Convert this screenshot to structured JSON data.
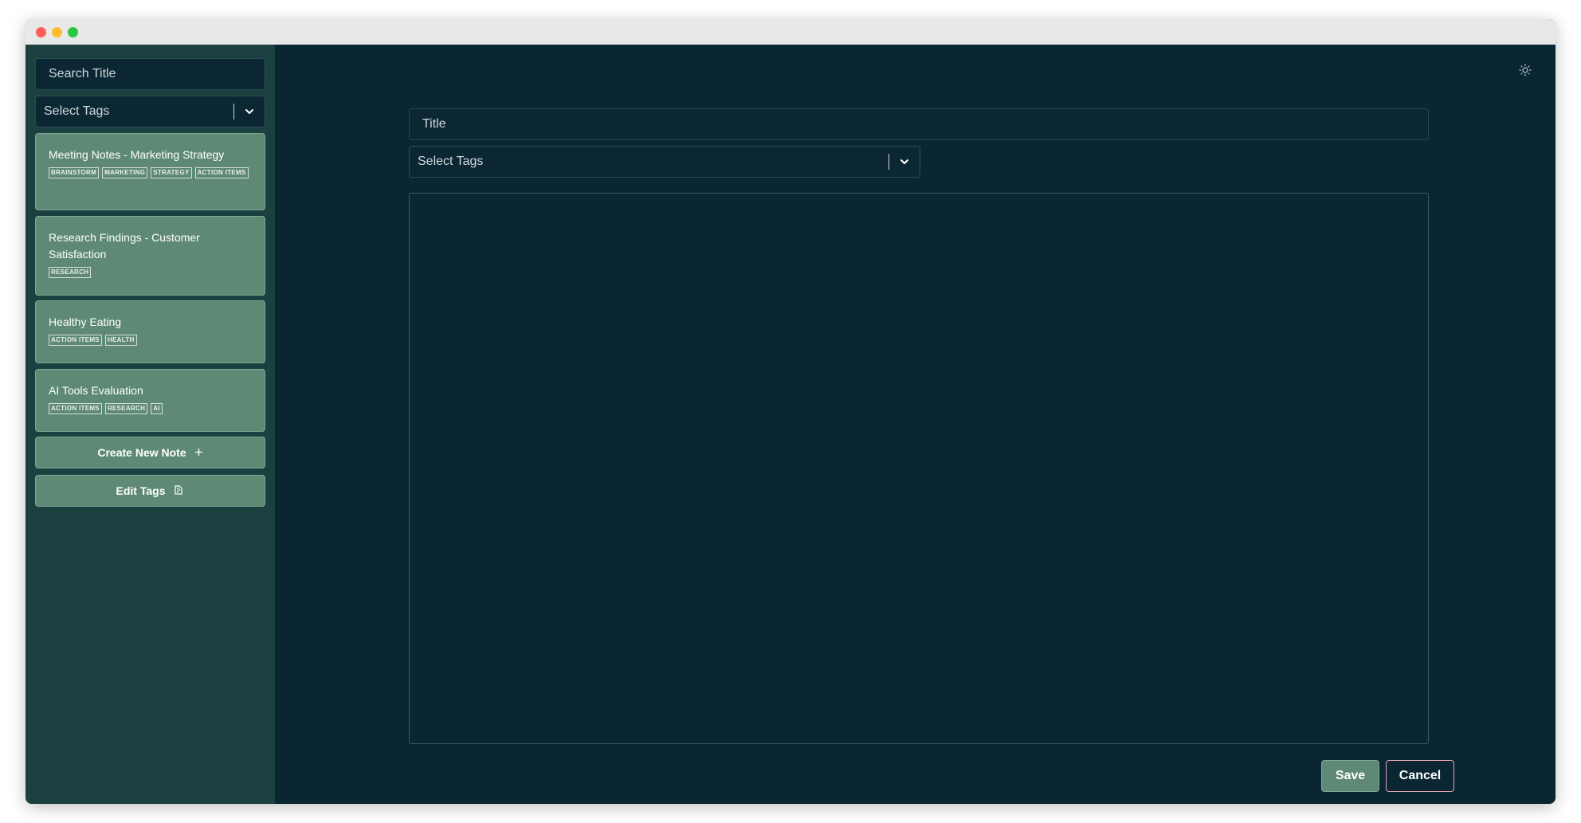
{
  "sidebar": {
    "search_placeholder": "Search Title",
    "tags_placeholder": "Select Tags",
    "notes": [
      {
        "title": "Meeting Notes - Marketing Strategy",
        "tags": [
          "BRAINSTORM",
          "MARKETING",
          "STRATEGY",
          "ACTION ITEMS"
        ]
      },
      {
        "title": "Research Findings - Customer Satisfaction",
        "tags": [
          "RESEARCH"
        ]
      },
      {
        "title": "Healthy Eating",
        "tags": [
          "ACTION ITEMS",
          "HEALTH"
        ]
      },
      {
        "title": "AI Tools Evaluation",
        "tags": [
          "ACTION ITEMS",
          "RESEARCH",
          "AI"
        ]
      }
    ],
    "create_note_label": "Create New Note",
    "edit_tags_label": "Edit Tags"
  },
  "editor": {
    "title_placeholder": "Title",
    "tags_placeholder": "Select Tags",
    "body_value": "",
    "save_label": "Save",
    "cancel_label": "Cancel"
  },
  "icons": {
    "theme_toggle": "sun-icon",
    "dropdown": "chevron-down-icon",
    "create": "plus-icon",
    "edit_tags": "tag-edit-icon"
  },
  "colors": {
    "sidebar_bg": "#1b4040",
    "main_bg": "#0a2633",
    "card_bg": "#5e8a75",
    "cancel_border": "#e4a7b5"
  }
}
